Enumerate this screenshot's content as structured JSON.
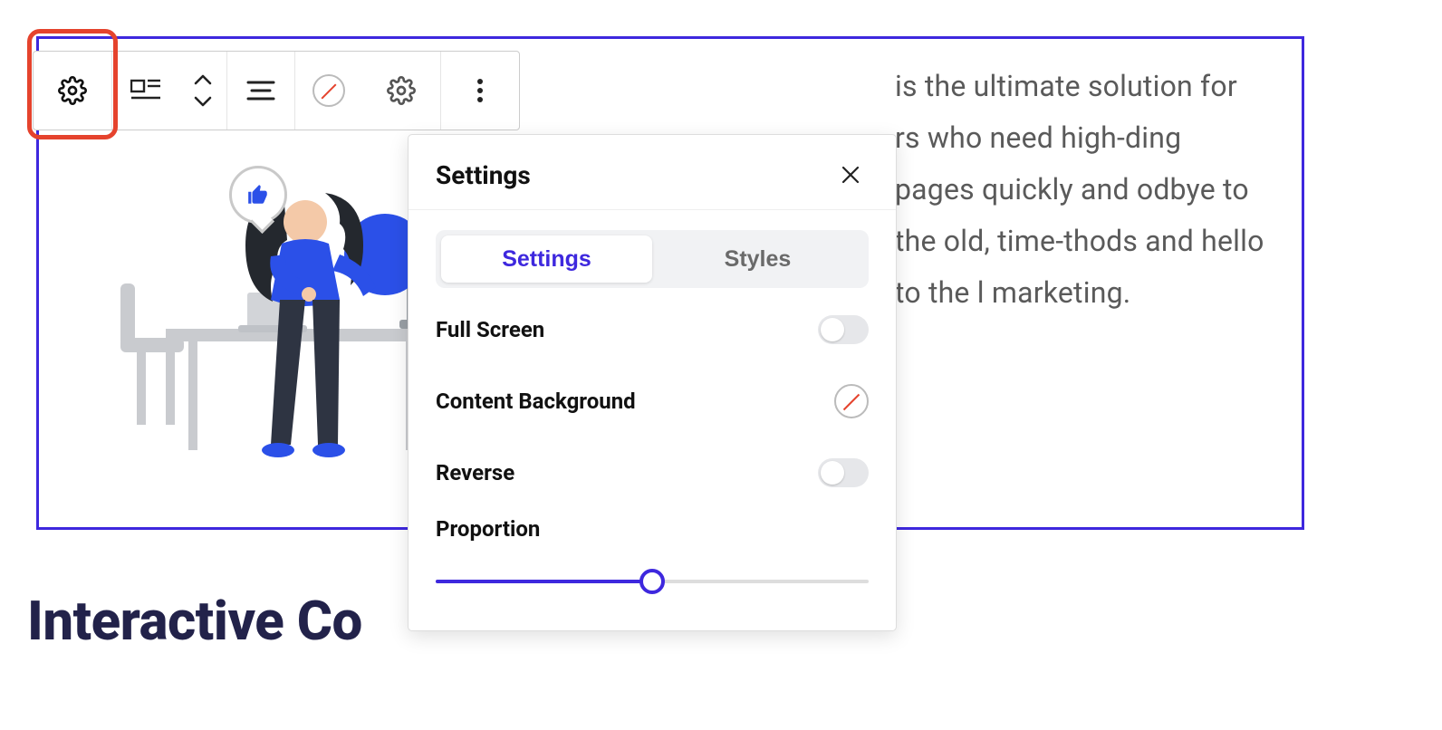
{
  "block": {
    "body_text": "is the ultimate solution for rs who need high-ding pages quickly and odbye to the old, time-thods and hello to the l marketing."
  },
  "heading": "Interactive Co",
  "popover": {
    "title": "Settings",
    "tabs": {
      "settings": "Settings",
      "styles": "Styles"
    },
    "rows": {
      "full_screen": "Full Screen",
      "content_background": "Content Background",
      "reverse": "Reverse"
    },
    "proportion": {
      "label": "Proportion",
      "value": 50
    }
  }
}
